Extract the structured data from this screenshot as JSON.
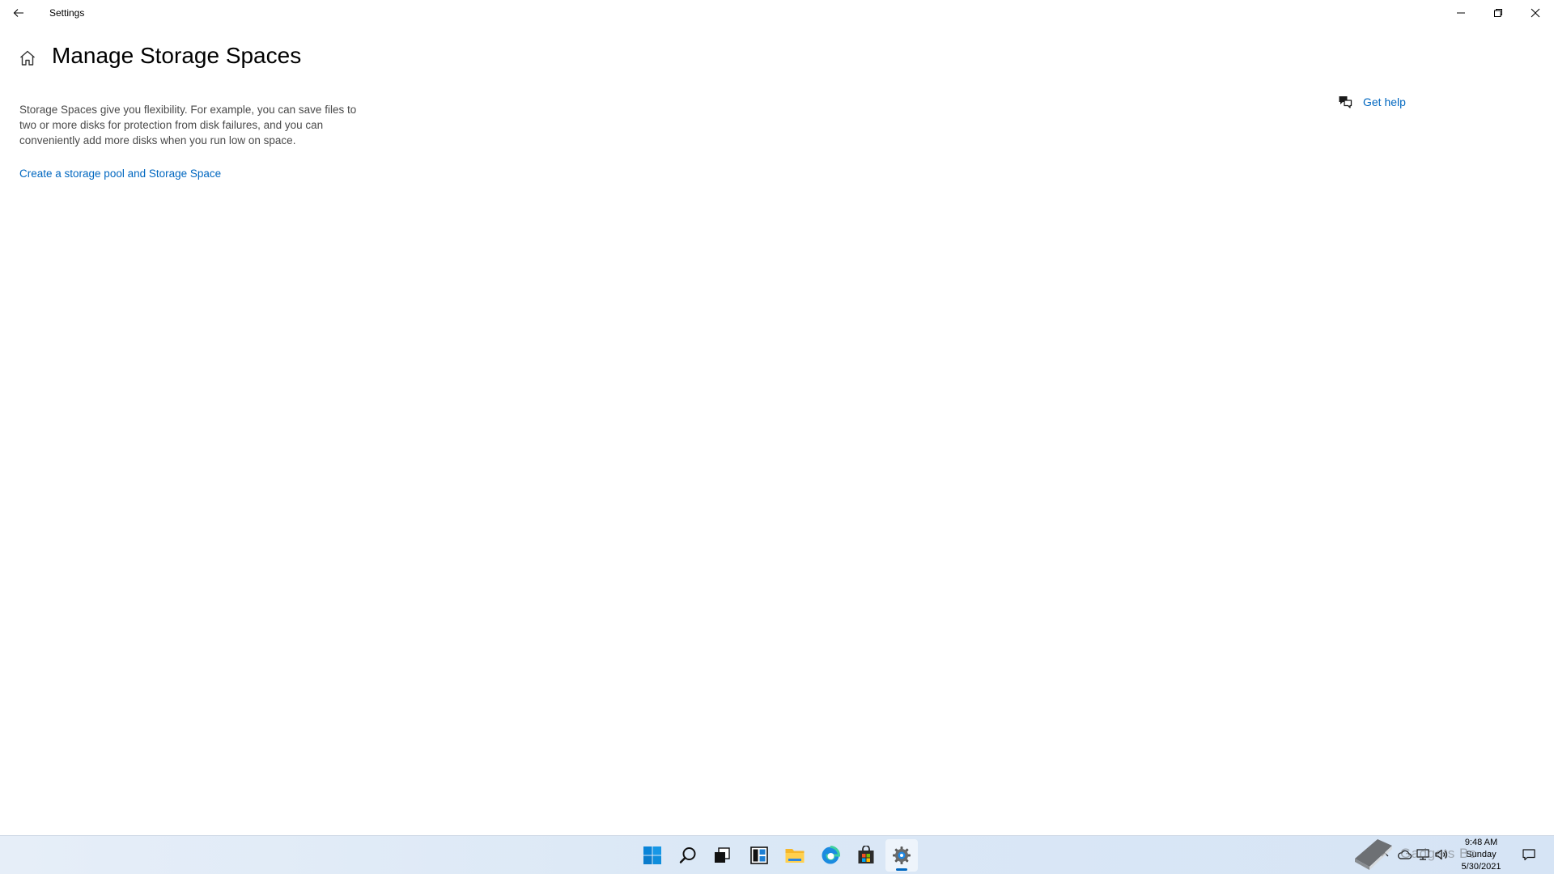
{
  "window": {
    "title": "Settings"
  },
  "page": {
    "title": "Manage Storage Spaces",
    "description": "Storage Spaces give you flexibility. For example, you can save files to two or more disks for protection from disk failures, and you can conveniently add more disks when you run low on space.",
    "create_link": "Create a storage pool and Storage Space"
  },
  "help": {
    "label": "Get help"
  },
  "taskbar": {
    "apps": [
      "start-icon",
      "search-icon",
      "task-view-icon",
      "widgets-icon",
      "file-explorer-icon",
      "edge-icon",
      "store-icon",
      "settings-icon"
    ],
    "active_app": "settings-icon"
  },
  "tray": {
    "time": "9:48 AM",
    "day": "Sunday",
    "date": "5/30/2021",
    "watermark": "Gadgets Bo"
  },
  "colors": {
    "accent": "#0067c0",
    "text_secondary": "#4a4a4a"
  }
}
